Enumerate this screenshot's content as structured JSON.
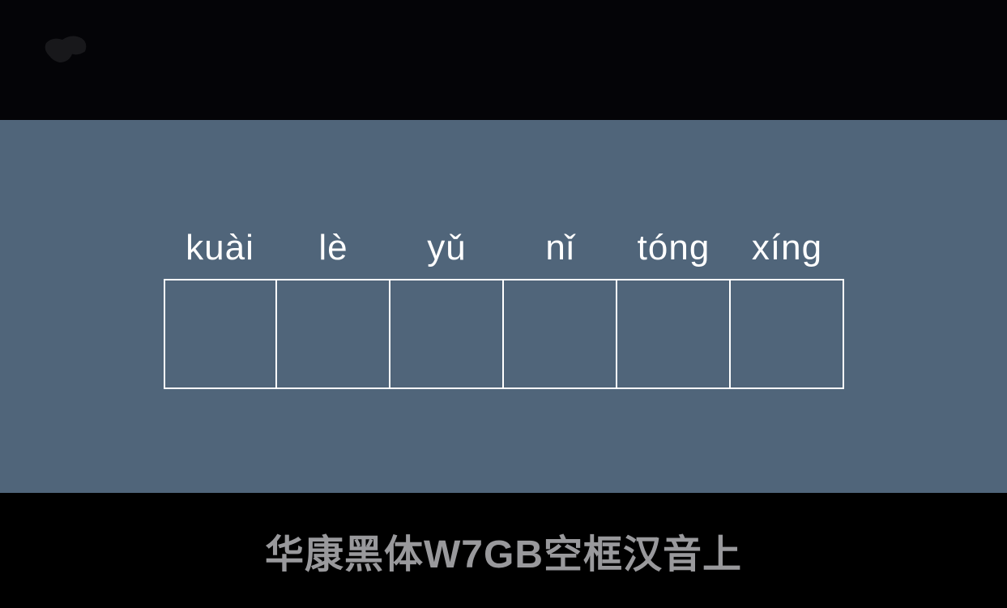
{
  "pinyin": [
    "kuài",
    "lè",
    "yǔ",
    "nǐ",
    "tóng",
    "xíng"
  ],
  "font_title": "华康黑体W7GB空框汉音上"
}
